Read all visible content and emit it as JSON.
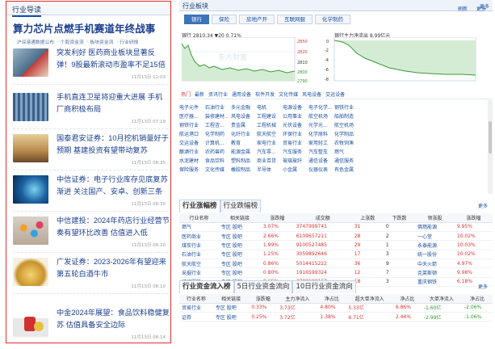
{
  "left": {
    "header": "行业导读",
    "headline": "算力芯片点燃手机赛道年终战事",
    "sublinks": [
      "沪深港通数据公布",
      "个股资金流",
      "板块资金流",
      "行业研报"
    ],
    "news": [
      {
        "title": "突发利好 医药商业板块显著反弹！9股最新滚动市盈率不足15倍",
        "date": "11月13日 12:03"
      },
      {
        "title": "手机直连卫星将迎重大进展 手机厂商积极布局",
        "date": "11月13日 07:19"
      },
      {
        "title": "国泰君安证券：10月挖机销量好于预期 基建投资有望带动复苏",
        "date": "11月13日 08:35"
      },
      {
        "title": "中信证券：电子行业库存见底复苏渐进 关注国产、安卓、创新三条",
        "date": "11月13日 08:30"
      },
      {
        "title": "中信建投：2024年药店行业经营节奏有望环比改善 估值进入低",
        "date": "11月13日 08:20"
      },
      {
        "title": "广发证券：2023-2026年有望迎来第五轮白酒牛市",
        "date": "11月13日 08:10"
      },
      {
        "title": "中金2024年展望：食品饮料稳健复苏 估值具备安全边际",
        "date": "11月13日 08:14"
      }
    ]
  },
  "right": {
    "header": "行业板块",
    "more": "更多",
    "tabs": [
      "银行",
      "保险",
      "房地产开",
      "互联网服",
      "化学制药"
    ],
    "refresh": "刷新",
    "chart1": {
      "title": "银行 2810.34 ▼20 0.71%",
      "watermark": "东方财富",
      "yticks": [
        "2850",
        "2820",
        "2810",
        "2800",
        "2790"
      ]
    },
    "chart2": {
      "title": "银行主力净流出 8.99亿元",
      "yticks": [
        "0",
        "-2",
        "-4",
        "-6",
        "-8"
      ]
    },
    "cats": [
      "热门",
      "最新",
      "资讯行业",
      "通用设备",
      "软件开发",
      "文化传媒",
      "风电设备",
      "交运设备"
    ],
    "grid": [
      [
        "电子元件",
        "石油行业",
        "多元金融",
        "电机",
        "电源设备",
        "电子化学...",
        "钢铁行业"
      ],
      [
        "医疗器...",
        "装修建材...",
        "风电设备",
        "工程建设",
        "公用事业",
        "航空机场",
        "船舶制造"
      ],
      [
        "钢铁行业",
        "工程咨...",
        "贵金属",
        "工程机械",
        "光伏设备",
        "光学光...",
        "航空机场"
      ],
      [
        "航运港口",
        "化学制药",
        "化纤行业",
        "航天航空",
        "环保行业",
        "化学原料",
        "化学制品"
      ],
      [
        "交运设备",
        "计算机...",
        "教育",
        "家电行业",
        "贸易行业",
        "家用轻工",
        "农牧饲渔"
      ],
      [
        "酿酒行业",
        "农药兽药",
        "能源金属",
        "汽车零...",
        "汽车服务",
        "汽车整车",
        "燃气"
      ],
      [
        "水泥建材",
        "食品饮料",
        "塑料制品",
        "商业百货",
        "玻璃玻纤",
        "通信设备",
        "通信服务"
      ],
      [
        "保险服务",
        "文化传媒",
        "橡胶制品",
        "半导体",
        "小金属",
        "仪器仪表",
        "有色金属"
      ]
    ],
    "rank": {
      "tabs": [
        "行业涨幅榜",
        "行业跌幅榜"
      ],
      "more": "更多",
      "cols": [
        "行业名称",
        "相关链接",
        "涨跌幅",
        "成交额",
        "上涨数",
        "下跌数",
        "领涨股",
        "涨跌幅"
      ],
      "rows": [
        [
          "燃气",
          "专区 股吧",
          "3.07%",
          "3747999741",
          "31",
          "0",
          "佛燃能源",
          "9.95%"
        ],
        [
          "医药商业",
          "专区 股吧",
          "2.66%",
          "6109657211",
          "28",
          "2",
          "一心堂",
          "10.02%"
        ],
        [
          "煤炭行业",
          "专区 股吧",
          "1.99%",
          "9100527485",
          "29",
          "1",
          "永泰能源",
          "10.03%"
        ],
        [
          "石油行业",
          "专区 股吧",
          "1.25%",
          "3059892646",
          "17",
          "3",
          "统一股份",
          "10.02%"
        ],
        [
          "航天航空",
          "专区 股吧",
          "0.86%",
          "5014415222",
          "36",
          "9",
          "中天火箭",
          "4.97%"
        ],
        [
          "采掘行业",
          "专区 股吧",
          "0.80%",
          "1916599324",
          "12",
          "7",
          "克莱斯顿",
          "9.98%"
        ],
        [
          "纺织服装",
          "专区 股吧",
          "0.65%",
          "3700190157",
          "18",
          "3",
          "重庆钢铁",
          "6.18%"
        ]
      ]
    },
    "flow": {
      "tabs": [
        "行业资金流入榜",
        "5日行业资金流向",
        "10日行业资金流向"
      ],
      "more": "更多",
      "cols": [
        "行业名称",
        "相关链接",
        "涨跌幅",
        "主力净流入",
        "净占比",
        "超大单净流入",
        "净占比",
        "大单净流入",
        "净占比"
      ],
      "rows": [
        [
          "贸易行业",
          "专区 股吧",
          "0.33%",
          "3.73亿",
          "4.80%",
          "5.33亿",
          "6.86%",
          "-1.60亿",
          "-2.06%"
        ],
        [
          "证券",
          "专区 股吧",
          "0.25%",
          "3.72亿",
          "1.38%",
          "6.71亿",
          "2.44%",
          "-2.99亿",
          "-1.06%"
        ]
      ]
    }
  }
}
